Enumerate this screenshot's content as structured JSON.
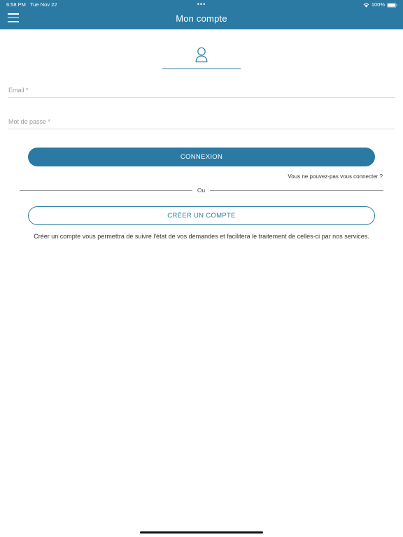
{
  "status_bar": {
    "time": "6:58 PM",
    "date": "Tue Nov 22",
    "dots": "•••",
    "battery": "100%",
    "icons": [
      "wifi-icon",
      "battery-icon"
    ]
  },
  "header": {
    "title": "Mon compte",
    "menu_icon": "hamburger-menu-icon",
    "background_color": "#2a7aa3"
  },
  "profile": {
    "icon": "user-icon"
  },
  "form": {
    "email_placeholder": "Email *",
    "password_placeholder": "Mot de passe *",
    "login_label": "CONNEXION",
    "forgot_link": "Vous ne pouvez-pas vous connecter ?",
    "divider_text": "Ou",
    "create_label": "CRÉER UN COMPTE",
    "info_text": "Créer un compte vous permettra de suivre l'état de vos demandes et facilitera le traitement de celles-ci par nos services."
  },
  "colors": {
    "accent": "#2a7aa3",
    "text": "#333333",
    "placeholder": "#9a9a9a"
  }
}
